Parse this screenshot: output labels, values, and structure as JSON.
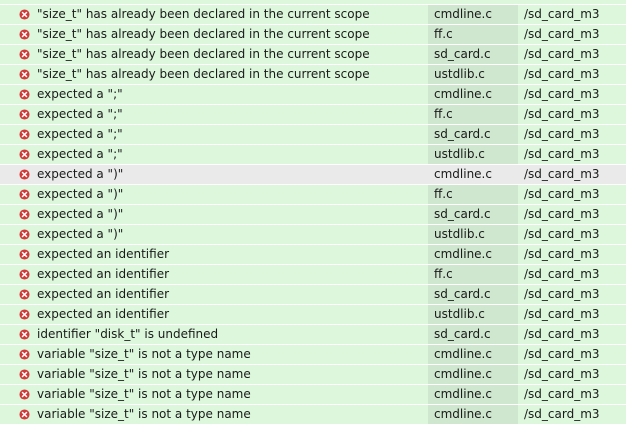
{
  "problems": [
    {
      "message": "\"size_t\" has already been declared in the current scope",
      "resource": "cmdline.c",
      "path": "/sd_card_m3",
      "severity_icon": "error-icon"
    },
    {
      "message": "\"size_t\" has already been declared in the current scope",
      "resource": "ff.c",
      "path": "/sd_card_m3",
      "severity_icon": "error-icon"
    },
    {
      "message": "\"size_t\" has already been declared in the current scope",
      "resource": "sd_card.c",
      "path": "/sd_card_m3",
      "severity_icon": "error-icon"
    },
    {
      "message": "\"size_t\" has already been declared in the current scope",
      "resource": "ustdlib.c",
      "path": "/sd_card_m3",
      "severity_icon": "error-icon"
    },
    {
      "message": "expected a \";\"",
      "resource": "cmdline.c",
      "path": "/sd_card_m3",
      "severity_icon": "error-icon"
    },
    {
      "message": "expected a \";\"",
      "resource": "ff.c",
      "path": "/sd_card_m3",
      "severity_icon": "error-icon"
    },
    {
      "message": "expected a \";\"",
      "resource": "sd_card.c",
      "path": "/sd_card_m3",
      "severity_icon": "error-icon"
    },
    {
      "message": "expected a \";\"",
      "resource": "ustdlib.c",
      "path": "/sd_card_m3",
      "severity_icon": "error-icon"
    },
    {
      "message": "expected a \")\"",
      "resource": "cmdline.c",
      "path": "/sd_card_m3",
      "severity_icon": "error-icon",
      "selected": true
    },
    {
      "message": "expected a \")\"",
      "resource": "ff.c",
      "path": "/sd_card_m3",
      "severity_icon": "error-icon"
    },
    {
      "message": "expected a \")\"",
      "resource": "sd_card.c",
      "path": "/sd_card_m3",
      "severity_icon": "error-icon"
    },
    {
      "message": "expected a \")\"",
      "resource": "ustdlib.c",
      "path": "/sd_card_m3",
      "severity_icon": "error-icon"
    },
    {
      "message": "expected an identifier",
      "resource": "cmdline.c",
      "path": "/sd_card_m3",
      "severity_icon": "error-icon"
    },
    {
      "message": "expected an identifier",
      "resource": "ff.c",
      "path": "/sd_card_m3",
      "severity_icon": "error-icon"
    },
    {
      "message": "expected an identifier",
      "resource": "sd_card.c",
      "path": "/sd_card_m3",
      "severity_icon": "error-icon"
    },
    {
      "message": "expected an identifier",
      "resource": "ustdlib.c",
      "path": "/sd_card_m3",
      "severity_icon": "error-icon"
    },
    {
      "message": "identifier \"disk_t\" is undefined",
      "resource": "sd_card.c",
      "path": "/sd_card_m3",
      "severity_icon": "error-icon"
    },
    {
      "message": "variable \"size_t\" is not a type name",
      "resource": "cmdline.c",
      "path": "/sd_card_m3",
      "severity_icon": "error-icon"
    },
    {
      "message": "variable \"size_t\" is not a type name",
      "resource": "cmdline.c",
      "path": "/sd_card_m3",
      "severity_icon": "error-icon"
    },
    {
      "message": "variable \"size_t\" is not a type name",
      "resource": "cmdline.c",
      "path": "/sd_card_m3",
      "severity_icon": "error-icon"
    },
    {
      "message": "variable \"size_t\" is not a type name",
      "resource": "cmdline.c",
      "path": "/sd_card_m3",
      "severity_icon": "error-icon"
    }
  ],
  "colors": {
    "row_background": "#dcf7dc",
    "resource_column_background": "#cfe6cf",
    "selected_row_background": "#eaeaea",
    "error_icon": "#d23a3a"
  }
}
